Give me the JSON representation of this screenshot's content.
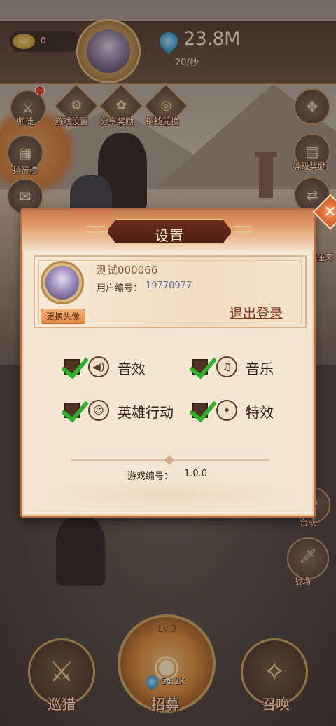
{
  "top_bar": {
    "gold_value": "0",
    "crystal_value": "23.8M",
    "rate_text": "20/秒"
  },
  "side_menu": {
    "left": [
      {
        "label": "师徒",
        "icon": "master-disciple-icon"
      },
      {
        "label": "排行榜",
        "icon": "ranking-icon"
      },
      {
        "label": "",
        "icon": "gift-icon"
      }
    ],
    "top": [
      {
        "label": "游戏设置",
        "icon": "settings-icon"
      },
      {
        "label": "分享奖励",
        "icon": "share-reward-icon"
      },
      {
        "label": "铜钱兑换",
        "icon": "coin-exchange-icon"
      }
    ],
    "right": [
      {
        "label": "",
        "icon": "tactics-icon"
      },
      {
        "label": "等级奖励",
        "icon": "level-reward-icon"
      },
      {
        "label": "往来",
        "icon": "exchange-icon"
      },
      {
        "label": "合成",
        "icon": "merge-icon"
      },
      {
        "label": "战场",
        "icon": "battlefield-icon"
      }
    ]
  },
  "bottom_nav": {
    "patrol_label": "巡猎",
    "recruit_label": "招募",
    "recruit_level": "Lv.3",
    "recruit_cost": "54.2K",
    "summon_label": "召唤"
  },
  "dialog": {
    "title": "设置",
    "profile": {
      "username": "测试000066",
      "userid_label": "用户编号：",
      "userid_value": "19770977",
      "change_avatar_label": "更换头像",
      "logout_label": "退出登录"
    },
    "options": [
      {
        "label": "音效",
        "checked": true,
        "icon": "speaker-icon"
      },
      {
        "label": "音乐",
        "checked": true,
        "icon": "music-note-icon"
      },
      {
        "label": "英雄行动",
        "checked": true,
        "icon": "person-icon"
      },
      {
        "label": "特效",
        "checked": true,
        "icon": "sparkle-icon"
      }
    ],
    "version_label": "游戏编号：",
    "version_value": "1.0.0"
  },
  "colors": {
    "dialog_bg": "#f3e6d2",
    "dialog_border": "#b86a3c",
    "check_green": "#2db22d",
    "title_plate": "#4b1e12"
  }
}
